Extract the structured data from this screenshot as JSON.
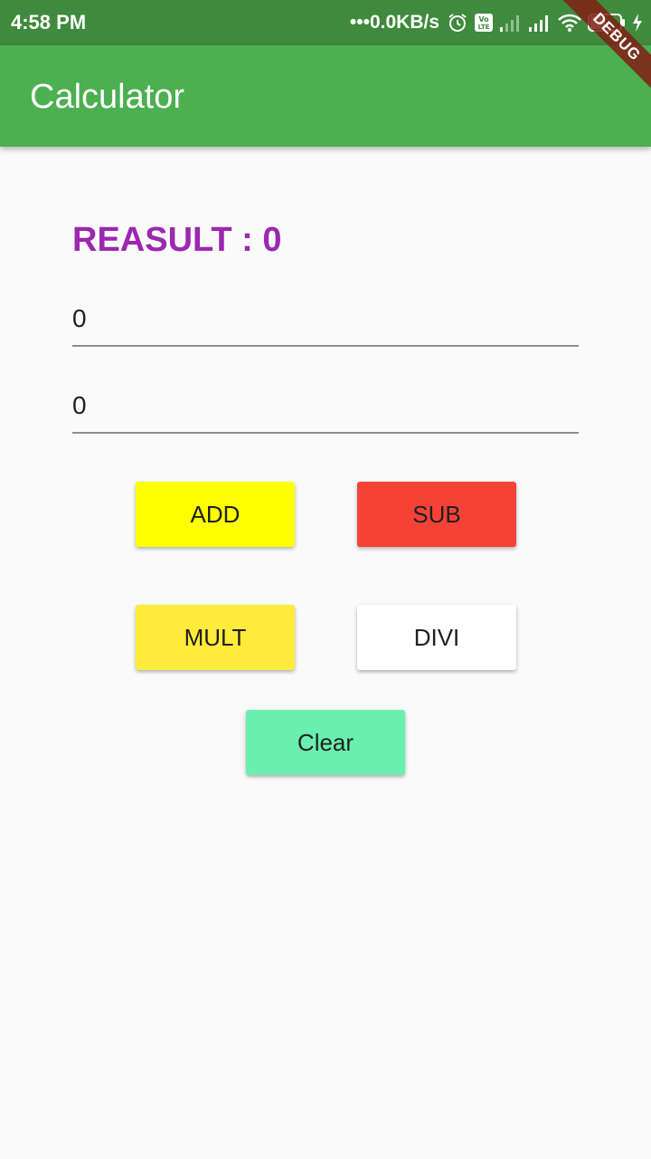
{
  "status_bar": {
    "time": "4:58 PM",
    "net_speed": "•••0.0KB/s",
    "battery": "49",
    "icons": [
      "alarm-icon",
      "volte-icon",
      "signal-weak-icon",
      "signal-icon",
      "wifi-icon",
      "battery-icon",
      "charging-icon"
    ]
  },
  "app_bar": {
    "title": "Calculator",
    "color": "#4caf50"
  },
  "debug_banner": "DEBUG",
  "result": {
    "label": "REASULT : 0",
    "color": "#9c27b0"
  },
  "fields": {
    "first_value": "0",
    "second_value": "0"
  },
  "buttons": {
    "add": {
      "label": "ADD",
      "color": "#ffff00"
    },
    "sub": {
      "label": "SUB",
      "color": "#f44336"
    },
    "mult": {
      "label": "MULT",
      "color": "#ffeb3b"
    },
    "divi": {
      "label": "DIVI",
      "color": "#ffffff"
    },
    "clear": {
      "label": "Clear",
      "color": "#69f0ae"
    }
  }
}
